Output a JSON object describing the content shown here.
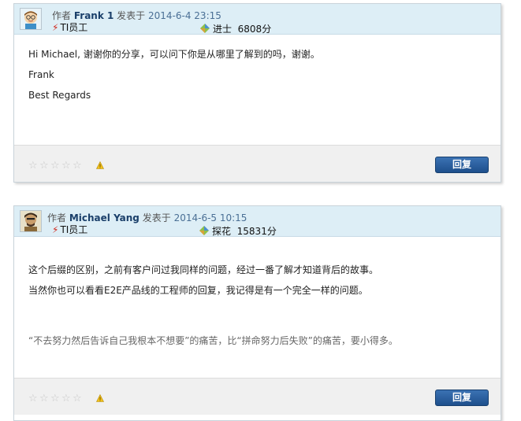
{
  "posts": [
    {
      "author_prefix": "作者",
      "author": "Frank 1",
      "posted_label": "发表于",
      "date": "2014-6-4 23:15",
      "role": "TI员工",
      "rank_name": "进士",
      "points": "6808分",
      "body": [
        "Hi Michael, 谢谢你的分享，可以问下你是从哪里了解到的吗，谢谢。",
        "Frank",
        "Best Regards"
      ],
      "quote": "",
      "reply_label": "回复"
    },
    {
      "author_prefix": "作者",
      "author": "Michael Yang",
      "posted_label": "发表于",
      "date": "2014-6-5 10:15",
      "role": "TI员工",
      "rank_name": "探花",
      "points": "15831分",
      "body": [
        "这个后缀的区别，之前有客户问过我同样的问题，经过一番了解才知道背后的故事。",
        "当然你也可以看看E2E产品线的工程师的回复，我记得是有一个完全一样的问题。"
      ],
      "quote": "“不去努力然后告诉自己我根本不想要”的痛苦，比“拼命努力后失败”的痛苦，要小得多。",
      "reply_label": "回复"
    }
  ],
  "icons": {
    "avatar_1": "cartoon-avatar-icon",
    "avatar_2": "cartoon-avatar-icon",
    "rank": "rank-badge-icon",
    "rating": "star-rating-icon",
    "report": "warning-icon",
    "employee": "ti-logo-icon"
  },
  "colors": {
    "header_bg": "#ddeef6",
    "reply_button": "#2a5f9e",
    "author_link": "#1a3f6a",
    "ti_red": "#d0261b"
  }
}
